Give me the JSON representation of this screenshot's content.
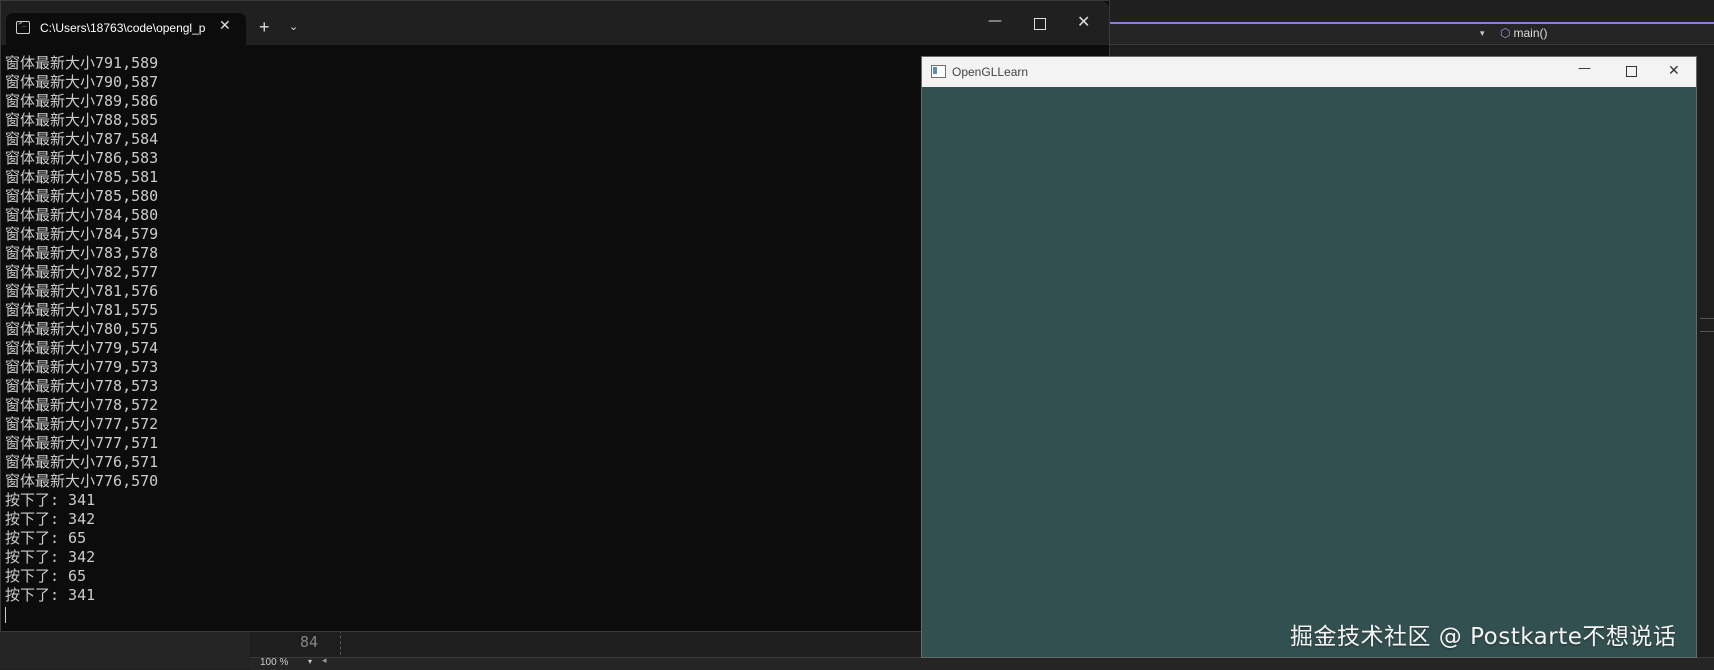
{
  "ide": {
    "function_selector": "main()",
    "line_number": "84",
    "zoom": "100 %"
  },
  "terminal": {
    "tab_title": "C:\\Users\\18763\\code\\opengl_p",
    "new_tab_label": "+",
    "output_lines": [
      "窗体最新大小791,589",
      "窗体最新大小790,587",
      "窗体最新大小789,586",
      "窗体最新大小788,585",
      "窗体最新大小787,584",
      "窗体最新大小786,583",
      "窗体最新大小785,581",
      "窗体最新大小785,580",
      "窗体最新大小784,580",
      "窗体最新大小784,579",
      "窗体最新大小783,578",
      "窗体最新大小782,577",
      "窗体最新大小781,576",
      "窗体最新大小781,575",
      "窗体最新大小780,575",
      "窗体最新大小779,574",
      "窗体最新大小779,573",
      "窗体最新大小778,573",
      "窗体最新大小778,572",
      "窗体最新大小777,572",
      "窗体最新大小777,571",
      "窗体最新大小776,571",
      "窗体最新大小776,570",
      "按下了: 341",
      "按下了: 342",
      "按下了: 65",
      "按下了: 342",
      "按下了: 65",
      "按下了: 341"
    ]
  },
  "gl_window": {
    "title": "OpenGLLearn",
    "clear_color": "#335050"
  },
  "watermark": "掘金技术社区 @ Postkarte不想说话",
  "icons": {
    "terminal_tab": "terminal-icon",
    "tab_close": "close-icon",
    "window_minimize": "minimize-icon",
    "window_maximize": "maximize-icon",
    "window_close": "close-icon",
    "gl_app": "app-window-icon",
    "function": "cube-icon"
  },
  "colors": {
    "ide_accent": "#8a7ce0",
    "terminal_bg": "#0c0c0c",
    "terminal_text": "#cccccc"
  }
}
